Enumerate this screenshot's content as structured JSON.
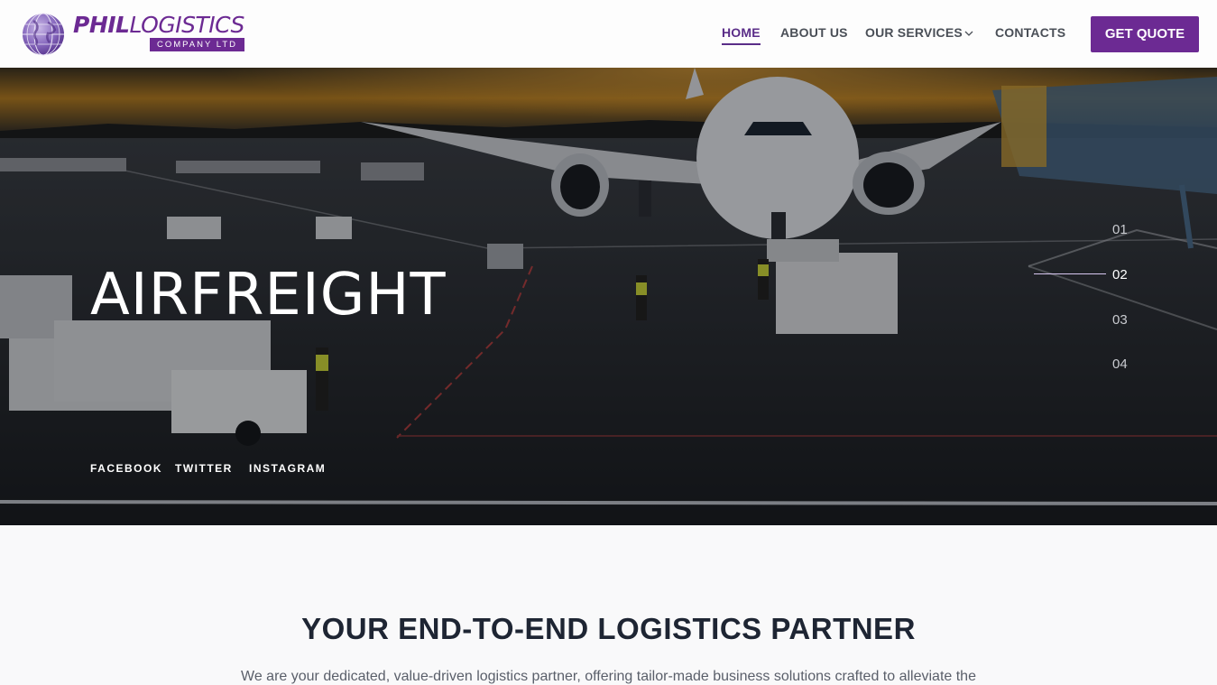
{
  "brand": {
    "name_bold": "PHIL",
    "name_thin": "LOGISTICS",
    "subtitle": "COMPANY LTD",
    "accent": "#6c2a93"
  },
  "nav": {
    "items": [
      {
        "label": "HOME",
        "active": true
      },
      {
        "label": "ABOUT US",
        "active": false
      },
      {
        "label": "OUR SERVICES",
        "active": false,
        "icon": "chevron-down-icon"
      },
      {
        "label": "CONTACTS",
        "active": false
      }
    ],
    "cta": "GET QUOTE"
  },
  "hero": {
    "title": "AIRFREIGHT",
    "slides": [
      "01",
      "02",
      "03",
      "04"
    ],
    "active_slide": "02",
    "social": [
      "FACEBOOK",
      "TWITTER",
      "INSTAGRAM"
    ]
  },
  "section": {
    "title": "YOUR END-TO-END LOGISTICS PARTNER",
    "text": "We are your dedicated, value-driven logistics partner, offering tailor-made business solutions crafted to alleviate the"
  }
}
